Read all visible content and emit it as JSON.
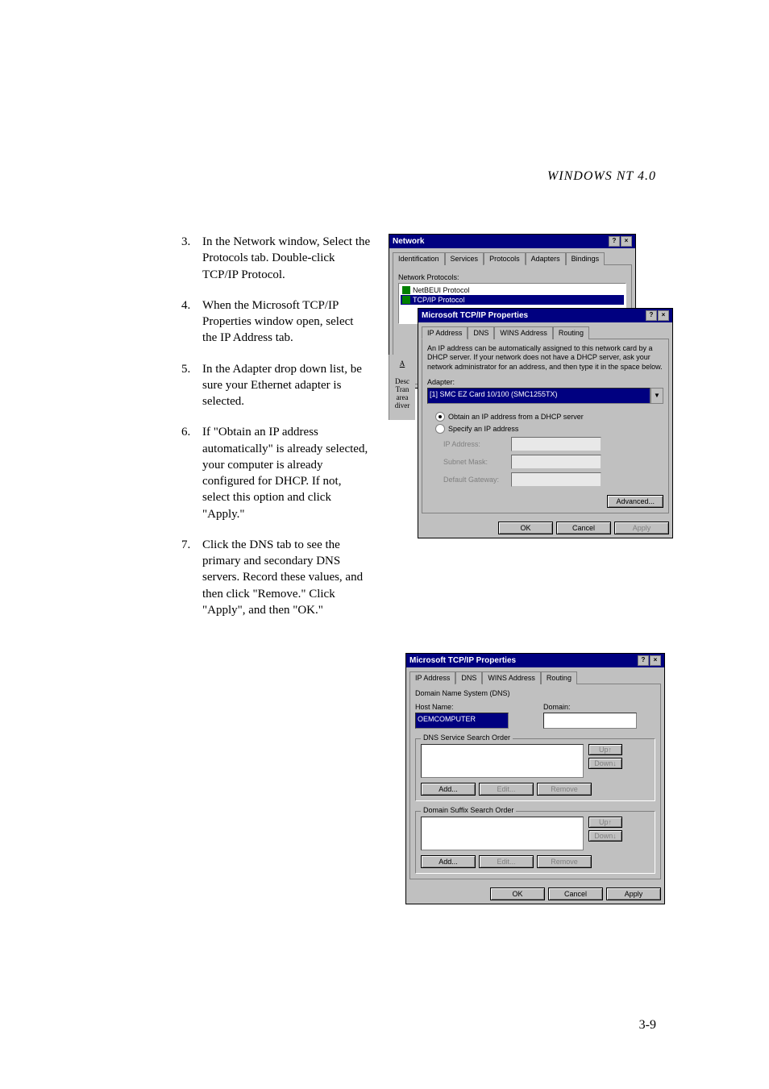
{
  "header": {
    "title": "WINDOWS NT 4.0"
  },
  "steps": [
    {
      "n": "3.",
      "text": "In the Network window, Select the Protocols tab. Double-click TCP/IP Protocol."
    },
    {
      "n": "4.",
      "text": "When the Microsoft TCP/IP Properties window open, select the IP Address tab."
    },
    {
      "n": "5.",
      "text": "In the Adapter drop down list, be sure your Ethernet adapter is selected."
    },
    {
      "n": "6.",
      "text": "If \"Obtain an IP address automatically\" is already selected, your computer is already configured for DHCP. If not, select this option and click \"Apply.\""
    },
    {
      "n": "7.",
      "text": "Click the DNS tab to see the primary and secondary DNS servers. Record these values, and then click \"Remove.\" Click \"Apply\", and then \"OK.\""
    }
  ],
  "win_network": {
    "title": "Network",
    "tabs": [
      "Identification",
      "Services",
      "Protocols",
      "Adapters",
      "Bindings"
    ],
    "active_tab": 2,
    "list_label": "Network Protocols:",
    "protocols": [
      "NetBEUI Protocol",
      "TCP/IP Protocol"
    ],
    "selected_protocol": 1,
    "side_labels": [
      "A",
      "Desc",
      "Tran",
      "area",
      "diver"
    ]
  },
  "win_tcpip": {
    "title": "Microsoft TCP/IP Properties",
    "tabs": [
      "IP Address",
      "DNS",
      "WINS Address",
      "Routing"
    ],
    "active_tab": 0,
    "desc": "An IP address can be automatically assigned to this network card by a DHCP server. If your network does not have a DHCP server, ask your network administrator for an address, and then type it in the space below.",
    "adapter_label": "Adapter:",
    "adapter_value": "[1] SMC EZ Card 10/100 (SMC1255TX)",
    "radio_obtain": "Obtain an IP address from a DHCP server",
    "radio_specify": "Specify an IP address",
    "ip_label": "IP Address:",
    "subnet_label": "Subnet Mask:",
    "gateway_label": "Default Gateway:",
    "btn_adv": "Advanced...",
    "btn_ok": "OK",
    "btn_cancel": "Cancel",
    "btn_apply": "Apply"
  },
  "win_dns": {
    "title": "Microsoft TCP/IP Properties",
    "tabs": [
      "IP Address",
      "DNS",
      "WINS Address",
      "Routing"
    ],
    "active_tab": 1,
    "group1": "Domain Name System (DNS)",
    "host_label": "Host Name:",
    "host_value": "OEMCOMPUTER",
    "domain_label": "Domain:",
    "group2": "DNS Service Search Order",
    "group3": "Domain Suffix Search Order",
    "btn_up": "Up↑",
    "btn_down": "Down↓",
    "btn_add": "Add...",
    "btn_edit": "Edit...",
    "btn_remove": "Remove",
    "btn_ok": "OK",
    "btn_cancel": "Cancel",
    "btn_apply": "Apply"
  },
  "page_number": "3-9"
}
